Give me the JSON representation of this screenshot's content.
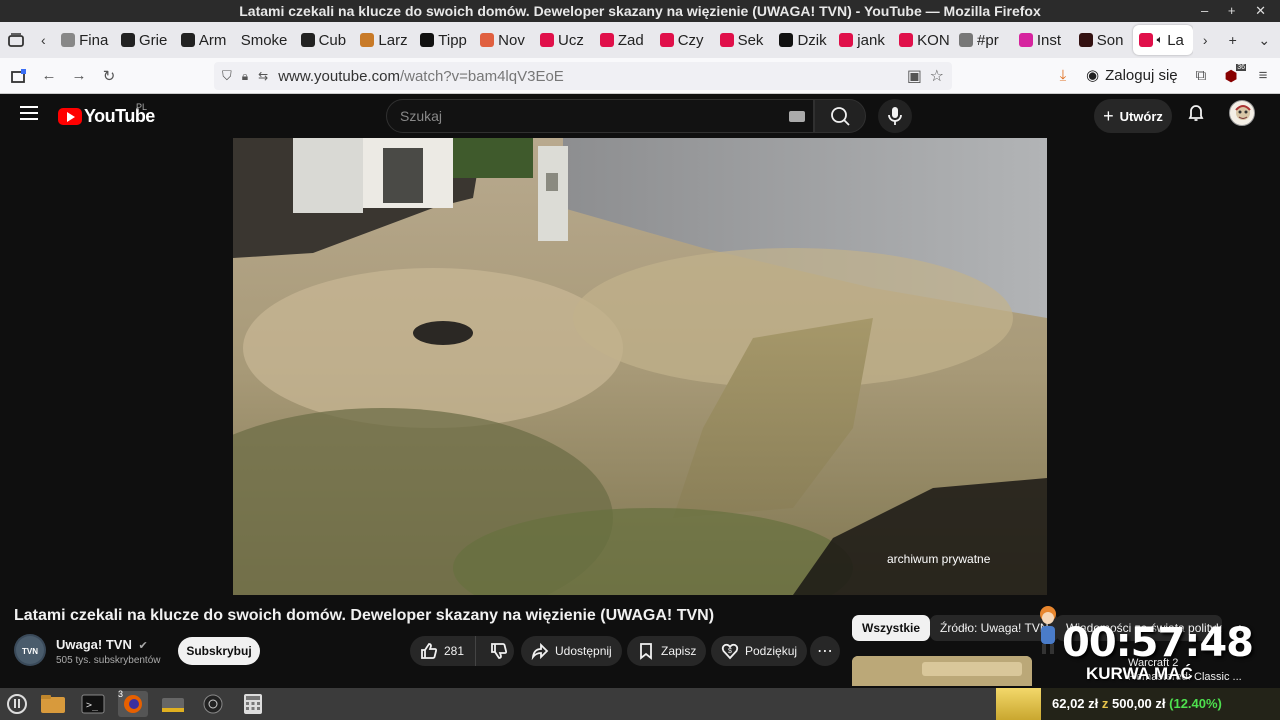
{
  "window": {
    "title": "Latami czekali na klucze do swoich domów. Deweloper skazany na więzienie (UWAGA! TVN) - YouTube — Mozilla Firefox",
    "controls": "– + ✕"
  },
  "tabs": [
    {
      "label": "Fina",
      "color": "#888888"
    },
    {
      "label": "Grie",
      "color": "#222222"
    },
    {
      "label": "Arm",
      "color": "#222222"
    },
    {
      "label": "Smoke",
      "color": "#e9e9ed"
    },
    {
      "label": "Cub",
      "color": "#222222"
    },
    {
      "label": "Larz",
      "color": "#c87a28"
    },
    {
      "label": "Tipp",
      "color": "#111111"
    },
    {
      "label": "Nov",
      "color": "#e06040"
    },
    {
      "label": "Ucz",
      "color": "#e0104a"
    },
    {
      "label": "Zad",
      "color": "#e0104a"
    },
    {
      "label": "Czy",
      "color": "#e0104a"
    },
    {
      "label": "Sek",
      "color": "#e0104a"
    },
    {
      "label": "Dzik",
      "color": "#111111"
    },
    {
      "label": "jank",
      "color": "#e0104a"
    },
    {
      "label": "KON",
      "color": "#e0104a"
    },
    {
      "label": "#pr",
      "color": "#777777"
    },
    {
      "label": "Inst",
      "color": "#d6249f"
    },
    {
      "label": "Son",
      "color": "#331111"
    },
    {
      "label": "La",
      "color": "#e0104a"
    }
  ],
  "toolbar": {
    "url_domain": "www.youtube.com",
    "url_path": "/watch?v=bam4lqV3EoE",
    "login_label": "Zaloguj się",
    "extension_badge": "36"
  },
  "youtube": {
    "region": "PL",
    "logo_text": "YouTube",
    "search_placeholder": "Szukaj",
    "create_label": "Utwórz"
  },
  "video": {
    "watermark": "archiwum prywatne",
    "title": "Latami czekali na klucze do swoich domów. Deweloper skazany na więzienie (UWAGA! TVN)",
    "channel_name": "Uwaga! TVN",
    "channel_subs": "505 tys. subskrybentów",
    "subscribe_label": "Subskrybuj",
    "like_count": "281",
    "share_label": "Udostępnij",
    "save_label": "Zapisz",
    "thanks_label": "Podziękuj"
  },
  "chips": [
    {
      "label": "Wszystkie",
      "active": true
    },
    {
      "label": "Źródło: Uwaga! TVN",
      "active": false
    },
    {
      "label": "Wiadomości ze świata polityki",
      "active": false
    }
  ],
  "sidebar_video": {
    "title_line1": "Warcraft 2",
    "title_line2": "Remastered: Classic ..."
  },
  "overlay": {
    "timer": "00:57:48",
    "caption": "KURWA MAĆ"
  },
  "taskbar": {
    "firefox_badge": "3"
  },
  "donation": {
    "current": "62,02 zł",
    "separator": "z",
    "goal": "500,00 zł",
    "percent_label": "(12.40%)",
    "progress": 0.124
  }
}
